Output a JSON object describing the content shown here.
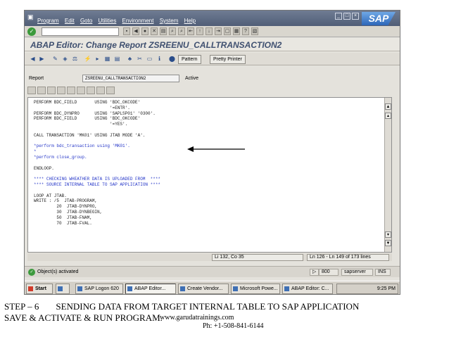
{
  "menubar": {
    "items": [
      "Program",
      "Edit",
      "Goto",
      "Utilities",
      "Environment",
      "System",
      "Help"
    ],
    "logo": "SAP"
  },
  "title": "ABAP Editor: Change Report ZSREENU_CALLTRANSACTION2",
  "app_toolbar": {
    "pattern": "Pattern",
    "pretty_printer": "Pretty Printer"
  },
  "report": {
    "label": "Report",
    "name": "ZSREENU_CALLTRANSACTION2",
    "status": "Active"
  },
  "code_lines": [
    {
      "text": "PERFORM BDC_FIELD       USING 'BDC_OKCODE'",
      "comment": false
    },
    {
      "text": "                              '=ENTR'.",
      "comment": false
    },
    {
      "text": "PERFORM BDC_DYNPRO      USING 'SAPLSP01' '0300'.",
      "comment": false
    },
    {
      "text": "PERFORM BDC_FIELD       USING 'BDC_OKCODE'",
      "comment": false
    },
    {
      "text": "                              '=YES'.",
      "comment": false
    },
    {
      "text": "",
      "comment": false
    },
    {
      "text": "CALL TRANSACTION 'MK01' USING JTAB MODE 'A'.",
      "comment": false
    },
    {
      "text": "",
      "comment": false
    },
    {
      "text": "*perform bdc_transaction using 'MK01'.",
      "comment": true
    },
    {
      "text": "*",
      "comment": true
    },
    {
      "text": "*perform close_group.",
      "comment": true
    },
    {
      "text": "",
      "comment": false
    },
    {
      "text": "ENDLOOP.",
      "comment": false
    },
    {
      "text": "",
      "comment": false
    },
    {
      "text": "**** CHECKING WHEATHER DATA IS UPLOADED FROM  ****",
      "comment": true
    },
    {
      "text": "**** SOURCE INTERNAL TABLE TO SAP APPLICATION ****",
      "comment": true
    },
    {
      "text": "",
      "comment": false
    },
    {
      "text": "LOOP AT JTAB.",
      "comment": false
    },
    {
      "text": "WRITE : /5  JTAB-PROGRAM,",
      "comment": false
    },
    {
      "text": "         20  JTAB-DYNPRO,",
      "comment": false
    },
    {
      "text": "         30  JTAB-DYNBEGIN,",
      "comment": false
    },
    {
      "text": "         50  JTAB-FNAM,",
      "comment": false
    },
    {
      "text": "         70  JTAB-FVAL.",
      "comment": false
    }
  ],
  "position": {
    "cursor": "Li 132, Co 35",
    "lines": "Ln 126 - Ln 149 of 173 lines"
  },
  "status": {
    "message": "Object(s) activated",
    "client": "800",
    "server": "sapserver",
    "mode": "INS"
  },
  "taskbar": {
    "start": "Start",
    "items": [
      "SAP Logon 620",
      "ABAP Editor...",
      "Create Vendor...",
      "Microsoft Powe...",
      "ABAP Editor: C..."
    ],
    "clock": "9:25 PM"
  },
  "caption": {
    "step": "STEP – 6",
    "title": "SENDING DATA FROM TARGET INTERNAL TABLE TO SAP APPLICATION",
    "line2": "SAVE & ACTIVATE & RUN PROGRAM.",
    "website": "www.garudatrainings.com",
    "phone": "Ph: +1-508-841-6144"
  },
  "colors": {
    "title_text": "#3f5070",
    "comment": "#2536c8",
    "menubar": "#515e77",
    "arrow": "#000000"
  }
}
